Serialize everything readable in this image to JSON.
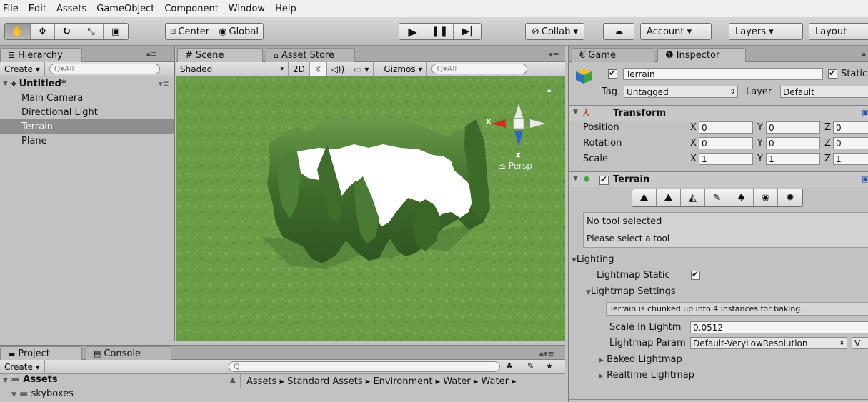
{
  "menubar": {
    "items": [
      "File",
      "Edit",
      "Assets",
      "GameObject",
      "Component",
      "Window",
      "Help"
    ]
  },
  "toolbar": {
    "pivot_label": "Center",
    "space_label": "Global",
    "collab_label": "Collab ▾",
    "account_label": "Account ▾",
    "layers_label": "Layers ▾",
    "layout_label": "Layout"
  },
  "hierarchy": {
    "tab": "Hierarchy",
    "create": "Create ▾",
    "search_placeholder": "Q▾All",
    "scene_name": "Untitled*",
    "items": [
      "Main Camera",
      "Directional Light",
      "Terrain",
      "Plane"
    ],
    "selected": "Terrain"
  },
  "scene": {
    "tab_scene": "Scene",
    "tab_store": "Asset Store",
    "shading": "Shaded",
    "mode_2d": "2D",
    "gizmos": "Gizmos ▾",
    "search_placeholder": "Q▾All",
    "gizmo_x": "x",
    "gizmo_z": "z",
    "persp": "≤ Persp"
  },
  "project": {
    "tab_project": "Project",
    "tab_console": "Console",
    "create": "Create ▾",
    "root": "Assets",
    "folder": "skyboxes",
    "breadcrumb": "Assets ▸ Standard Assets ▸ Environment ▸ Water ▸ Water ▸"
  },
  "inspector": {
    "tab_game": "Game",
    "tab_inspector": "Inspector",
    "object_name": "Terrain",
    "static_label": "Static",
    "tag_label": "Tag",
    "tag_value": "Untagged",
    "layer_label": "Layer",
    "layer_value": "Default",
    "transform": {
      "title": "Transform",
      "rows": [
        {
          "label": "Position",
          "x": "0",
          "y": "0",
          "z": "0"
        },
        {
          "label": "Rotation",
          "x": "0",
          "y": "0",
          "z": "0"
        },
        {
          "label": "Scale",
          "x": "1",
          "y": "1",
          "z": "1"
        }
      ]
    },
    "terrain": {
      "title": "Terrain",
      "status": "No tool selected",
      "hint": "Please select a tool"
    },
    "lighting": {
      "title": "Lighting",
      "lightmap_static": "Lightmap Static",
      "lightmap_settings": "Lightmap Settings",
      "info": "Terrain is chunked up into 4 instances for baking.",
      "scale_label": "Scale In Lightm",
      "scale_value": "0.0512",
      "param_label": "Lightmap Param",
      "param_value": "Default-VeryLowResolution",
      "param_btn": "V",
      "baked": "Baked Lightmap",
      "realtime": "Realtime Lightmap"
    }
  },
  "colors": {
    "panel": "#c2c2c2",
    "selected": "#8e8e8e",
    "grass": "#6a9a4a",
    "accent_blue": "#3060c0"
  }
}
